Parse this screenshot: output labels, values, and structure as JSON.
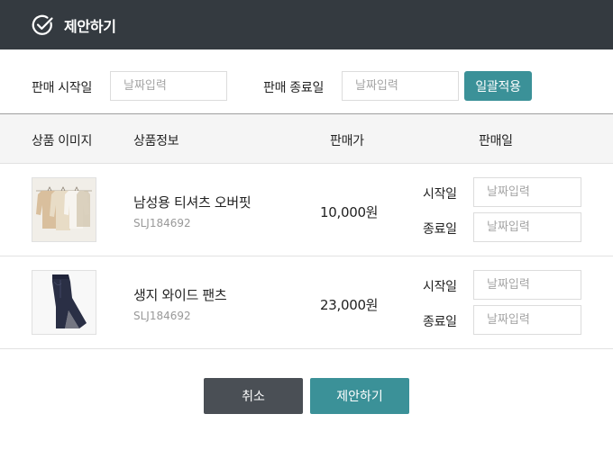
{
  "header": {
    "title": "제안하기",
    "icon": "check-circle-icon"
  },
  "period": {
    "start_label": "판매 시작일",
    "start_placeholder": "날짜입력",
    "end_label": "판매 종료일",
    "end_placeholder": "날짜입력",
    "apply_label": "일괄적용"
  },
  "table": {
    "columns": [
      "상품 이미지",
      "상품정보",
      "판매가",
      "판매일"
    ],
    "rows": [
      {
        "image": "clothing-rack-image",
        "name": "남성용 티셔츠 오버핏",
        "code": "SLJ184692",
        "price": "10,000원",
        "start_label": "시작일",
        "start_placeholder": "날짜입력",
        "end_label": "종료일",
        "end_placeholder": "날짜입력"
      },
      {
        "image": "jeans-image",
        "name": "생지 와이드 팬츠",
        "code": "SLJ184692",
        "price": "23,000원",
        "start_label": "시작일",
        "start_placeholder": "날짜입력",
        "end_label": "종료일",
        "end_placeholder": "날짜입력"
      }
    ]
  },
  "footer": {
    "cancel_label": "취소",
    "submit_label": "제안하기"
  },
  "colors": {
    "header_bg": "#343a40",
    "accent": "#3b9198",
    "cancel_bg": "#4a4f55"
  }
}
